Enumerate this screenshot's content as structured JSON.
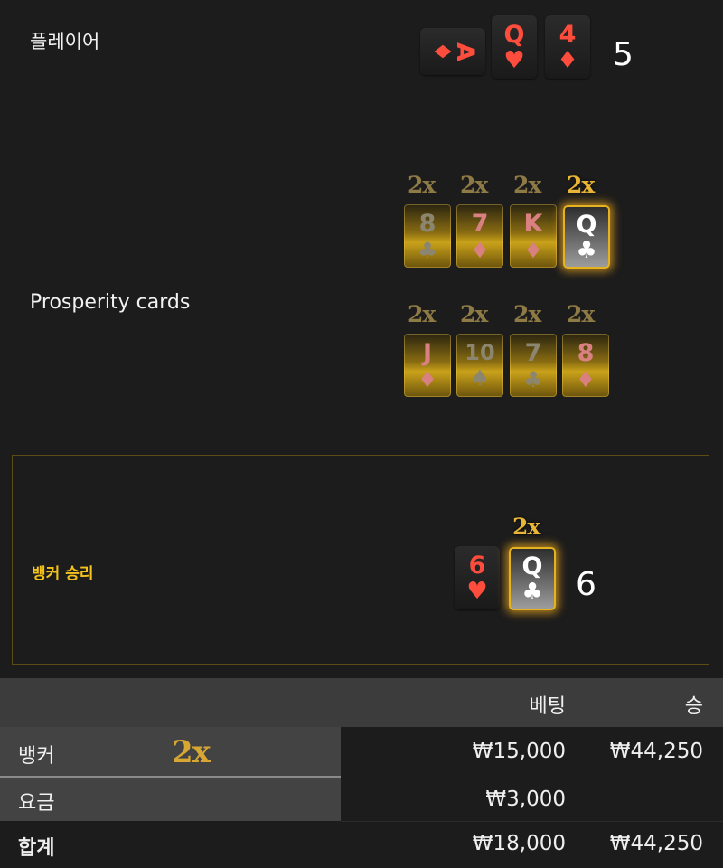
{
  "player": {
    "label": "플레이어",
    "cards": [
      {
        "rank": "A",
        "suit": "♦",
        "color": "red",
        "orientation": "sideways"
      },
      {
        "rank": "Q",
        "suit": "♥",
        "color": "red"
      },
      {
        "rank": "4",
        "suit": "♦",
        "color": "red"
      }
    ],
    "score": "5"
  },
  "prosperity": {
    "label": "Prosperity cards",
    "multiplier": "2x",
    "row1": [
      {
        "rank": "8",
        "suit": "♣",
        "style": "dim-gray",
        "multiplier": "2x",
        "highlight": false
      },
      {
        "rank": "7",
        "suit": "♦",
        "style": "dim-red",
        "multiplier": "2x",
        "highlight": false
      },
      {
        "rank": "K",
        "suit": "♦",
        "style": "dim-red",
        "multiplier": "2x",
        "highlight": false
      },
      {
        "rank": "Q",
        "suit": "♣",
        "style": "lit",
        "multiplier": "2x",
        "highlight": true
      }
    ],
    "row2": [
      {
        "rank": "J",
        "suit": "♦",
        "style": "dim-red",
        "multiplier": "2x"
      },
      {
        "rank": "10",
        "suit": "♠",
        "style": "dim-gray",
        "multiplier": "2x"
      },
      {
        "rank": "7",
        "suit": "♣",
        "style": "dim-gray",
        "multiplier": "2x"
      },
      {
        "rank": "8",
        "suit": "♦",
        "style": "dim-red",
        "multiplier": "2x"
      }
    ]
  },
  "banker": {
    "result_label": "뱅커 승리",
    "cards": [
      {
        "rank": "6",
        "suit": "♥",
        "color": "red"
      },
      {
        "rank": "Q",
        "suit": "♣",
        "style": "lit",
        "multiplier": "2x"
      }
    ],
    "score": "6"
  },
  "table": {
    "headers": {
      "bet": "베팅",
      "win": "승"
    },
    "rows": [
      {
        "label": "뱅커",
        "multiplier": "2x",
        "bet": "₩15,000",
        "win": "₩44,250"
      },
      {
        "label": "요금",
        "bet": "₩3,000",
        "win": ""
      },
      {
        "label": "합계",
        "bet": "₩18,000",
        "win": "₩44,250"
      }
    ]
  },
  "colors": {
    "accent_gold": "#f4c21d",
    "card_red": "#ff4d3d",
    "background": "#1c1c1c"
  }
}
